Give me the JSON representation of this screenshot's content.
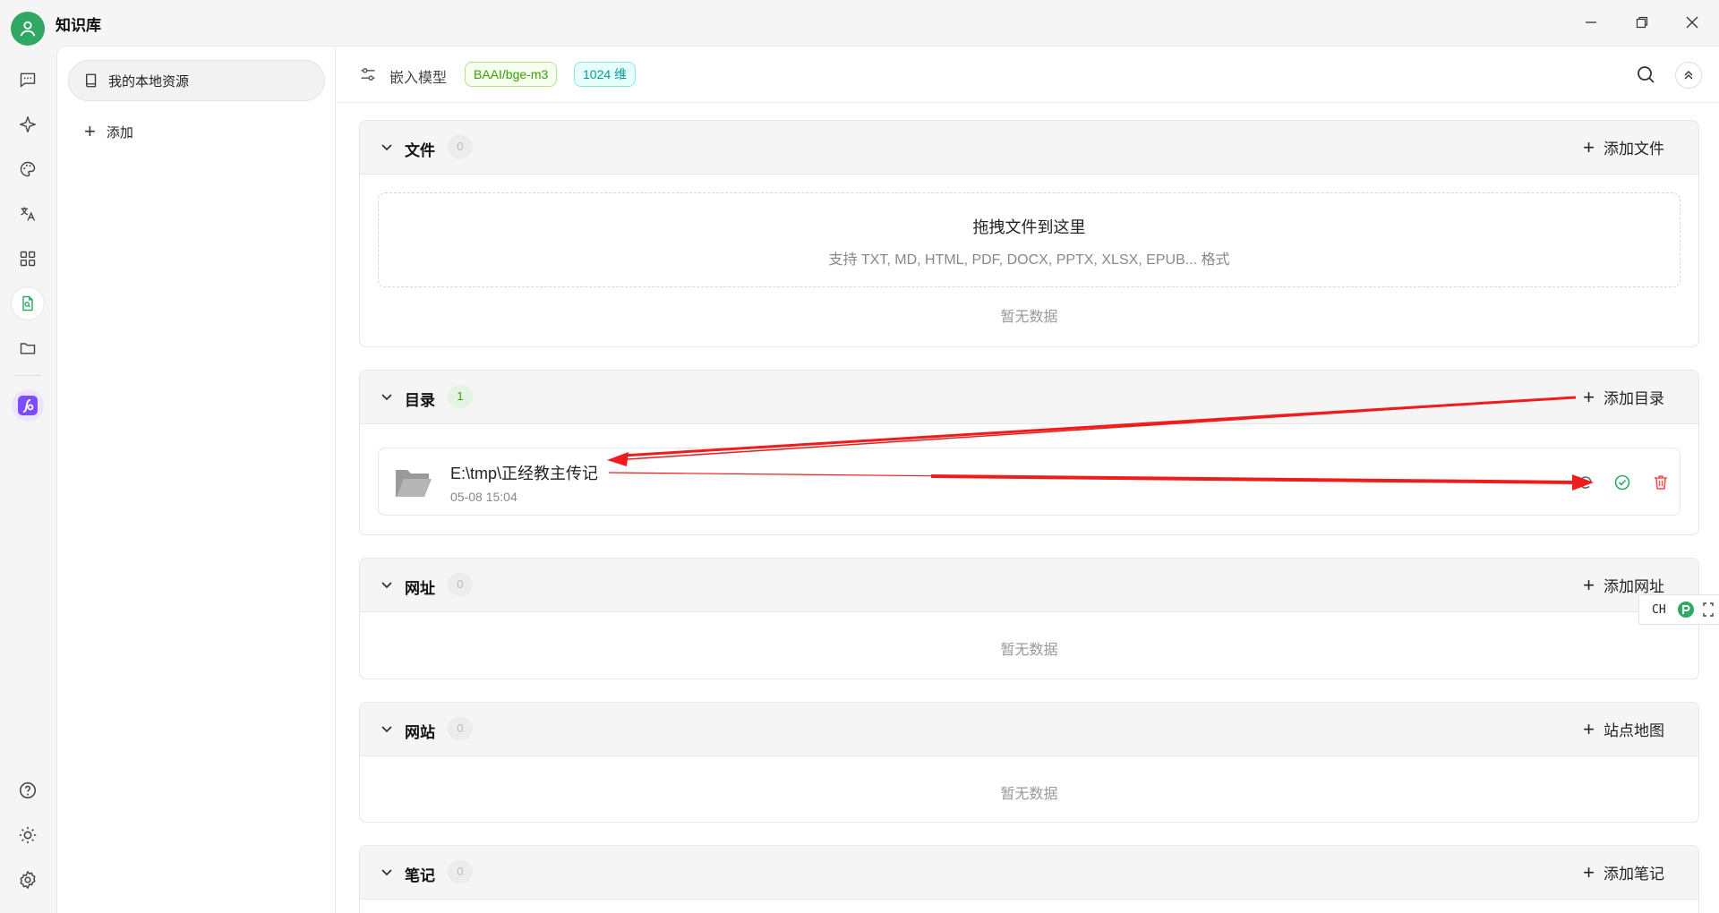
{
  "app": {
    "title": "知识库"
  },
  "sidebar": {
    "kb_name": "我的本地资源",
    "add_label": "添加"
  },
  "header": {
    "model_label": "嵌入模型",
    "model_tag": "BAAI/bge-m3",
    "dim_tag": "1024 维"
  },
  "sections": {
    "files": {
      "title": "文件",
      "count": "0",
      "action": "添加文件",
      "drop_title": "拖拽文件到这里",
      "drop_sub": "支持 TXT, MD, HTML, PDF, DOCX, PPTX, XLSX, EPUB... 格式",
      "empty": "暂无数据"
    },
    "dirs": {
      "title": "目录",
      "count": "1",
      "action": "添加目录",
      "items": [
        {
          "path": "E:\\tmp\\正经教主传记",
          "time": "05-08 15:04"
        }
      ]
    },
    "urls": {
      "title": "网址",
      "count": "0",
      "action": "添加网址",
      "empty": "暂无数据"
    },
    "sites": {
      "title": "网站",
      "count": "0",
      "action": "站点地图",
      "empty": "暂无数据"
    },
    "notes": {
      "title": "笔记",
      "count": "0",
      "action": "添加笔记"
    }
  },
  "ime": {
    "label": "CH"
  },
  "colors": {
    "accent": "#2fa864",
    "danger": "#ff4d4f",
    "annotation": "#ee1c1c"
  }
}
